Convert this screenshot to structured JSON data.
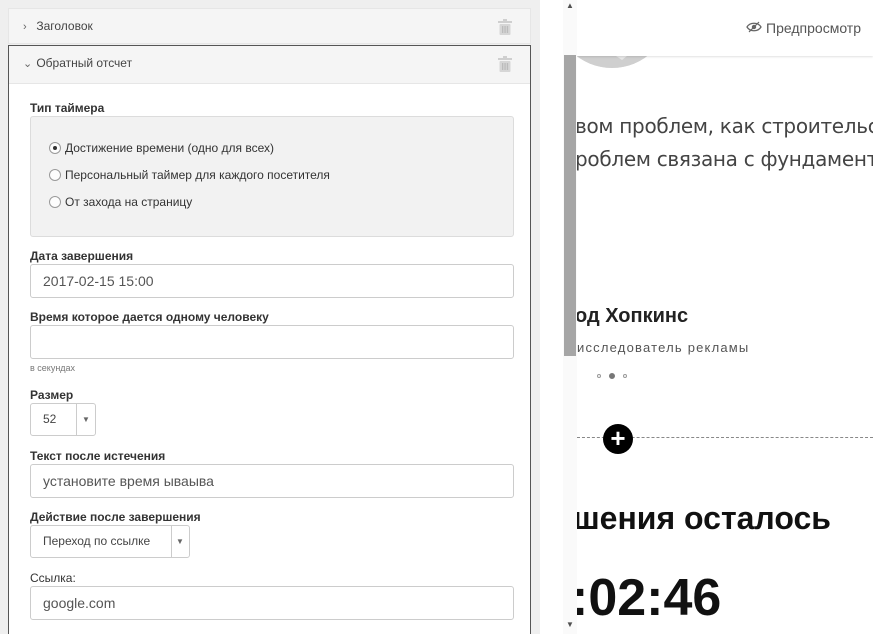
{
  "editor": {
    "collapsed_section": {
      "title": "Заголовок"
    },
    "expanded_section": {
      "title": "Обратный отсчет"
    },
    "timer_type": {
      "label": "Тип таймера",
      "options": [
        {
          "label": "Достижение времени (одно для всех)",
          "selected": true
        },
        {
          "label": "Персональный таймер для каждого посетителя",
          "selected": false
        },
        {
          "label": "От захода на страницу",
          "selected": false
        }
      ]
    },
    "end_date": {
      "label": "Дата завершения",
      "value": "2017-02-15 15:00"
    },
    "per_person_time": {
      "label": "Время которое дается одному человеку",
      "value": "",
      "hint": "в секундах"
    },
    "size": {
      "label": "Размер",
      "value": "52"
    },
    "expired_text": {
      "label": "Текст после истечения",
      "value": "установите время ываыва"
    },
    "after_action": {
      "label": "Действие после завершения",
      "value": "Переход по ссылке"
    },
    "link": {
      "label": "Ссылка:",
      "value": "google.com"
    }
  },
  "preview": {
    "button_label": "Предпросмотр",
    "text_line_1": "вом проблем, как строительс",
    "text_line_2": "роблем связана с фундамент",
    "name": "од Хопкинс",
    "role": "исследователь рекламы",
    "heading": "шения осталось",
    "timer": ":02:46"
  },
  "icons": {
    "collapsed_chevron": "chevron-right-icon",
    "expanded_chevron": "chevron-down-icon",
    "delete": "trash-icon",
    "preview": "eye-icon",
    "add": "plus-icon"
  },
  "colors": {
    "panel_bg": "#efefef",
    "scroll_thumb": "#a6a6a6",
    "add_button": "#000000"
  }
}
